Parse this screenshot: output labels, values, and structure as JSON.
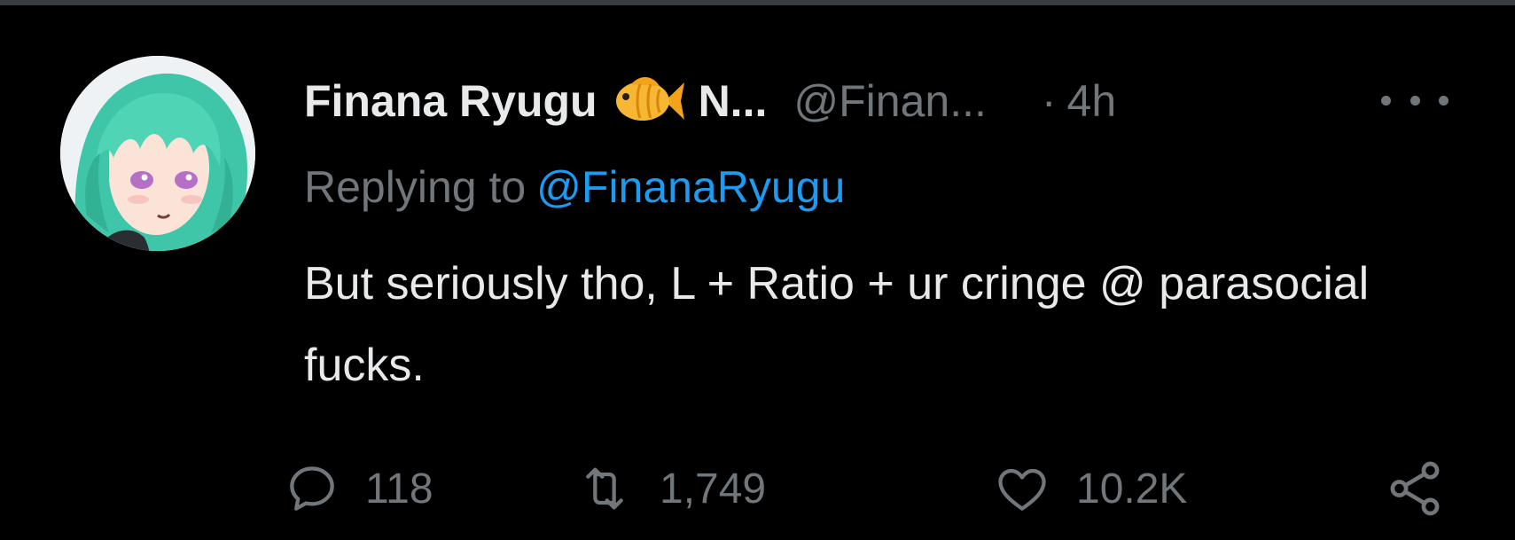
{
  "tweet": {
    "display_name": "Finana Ryugu",
    "name_suffix": "N...",
    "handle": "@Finan...",
    "separator": "·",
    "time": "4h",
    "reply_label": "Replying to",
    "reply_handle": "@FinanaRyugu",
    "text": "But seriously tho, L + Ratio + ur cringe @ parasocial fucks.",
    "icons": {
      "verified_emoji": "tropical-fish-icon",
      "more": "more-icon",
      "reply": "reply-icon",
      "retweet": "retweet-icon",
      "like": "heart-icon",
      "share": "share-icon"
    }
  },
  "actions": {
    "replies": "118",
    "retweets": "1,749",
    "likes": "10.2K"
  },
  "colors": {
    "background": "#000000",
    "text_primary": "#e7e9ea",
    "text_secondary": "#71767b",
    "link": "#1d9bf0",
    "avatar_hair": "#3fc6a8",
    "fish": "#f5a623"
  }
}
